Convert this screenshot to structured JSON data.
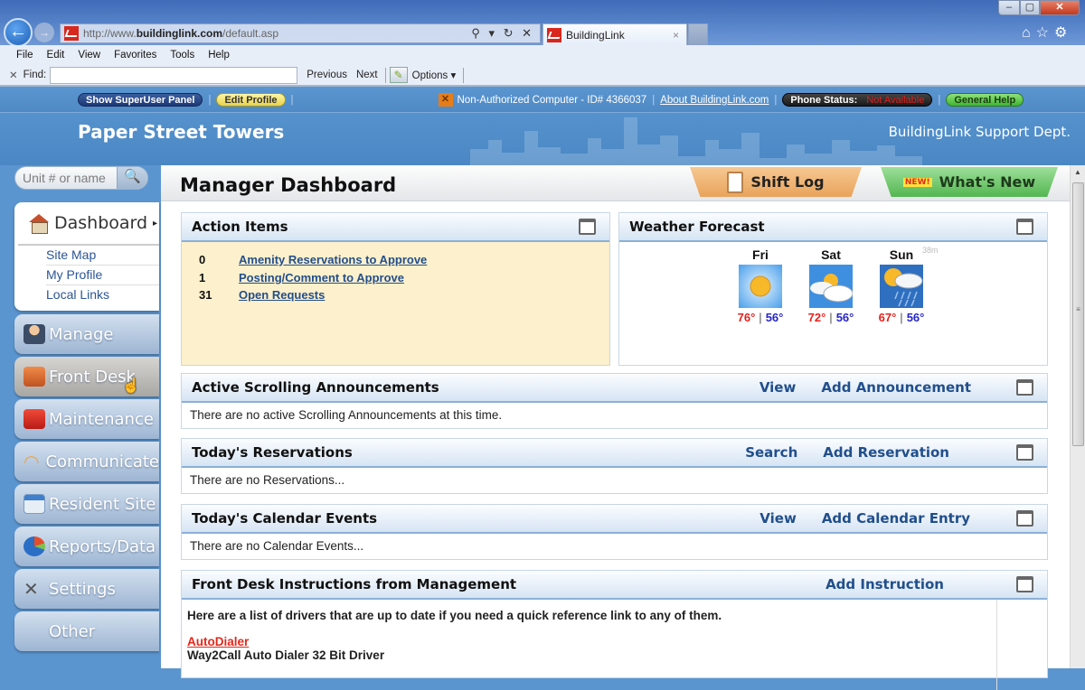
{
  "browser": {
    "url_prefix": "http://www.",
    "url_host": "buildinglink.com",
    "url_path": "/default.asp",
    "address_tools": "⚲ ▾ ↻ ✕",
    "tab_title": "BuildingLink",
    "tab_close": "×",
    "menu": [
      "File",
      "Edit",
      "View",
      "Favorites",
      "Tools",
      "Help"
    ],
    "find_label": "Find:",
    "find_value": "",
    "find_previous": "Previous",
    "find_next": "Next",
    "find_options": "Options ▾",
    "window_controls": {
      "minimize": "–",
      "maximize": "▢",
      "close": "✕"
    },
    "right_tools": "⌂☆⚙"
  },
  "topbar": {
    "superuser_button": "Show SuperUser Panel",
    "edit_profile_button": "Edit Profile",
    "computer_status": "Non-Authorized Computer - ID#  4366037",
    "about_link": "About BuildingLink.com",
    "phone_status_label": "Phone Status:",
    "phone_status_value": "Not Available",
    "general_help_button": "General Help"
  },
  "header": {
    "building_name": "Paper Street Towers",
    "department": "BuildingLink Support Dept."
  },
  "sidebar": {
    "search_placeholder": "Unit # or name",
    "search_icon": "🔍",
    "dashboard_label": "Dashboard",
    "dashboard_arrow": "▸",
    "sublinks": [
      "Site Map",
      "My Profile",
      "Local Links"
    ],
    "nav": [
      {
        "label": "Manage",
        "icon": "manager-icon",
        "color": "#4f6a8f"
      },
      {
        "label": "Front Desk",
        "icon": "front-desk-icon",
        "color": "#d8642c"
      },
      {
        "label": "Maintenance",
        "icon": "toolbox-icon",
        "color": "#d42a22"
      },
      {
        "label": "Communicate",
        "icon": "wifi-icon",
        "color": "#f0a23a"
      },
      {
        "label": "Resident Site",
        "icon": "website-icon",
        "color": "#7a9cc4"
      },
      {
        "label": "Reports/Data",
        "icon": "pie-chart-icon",
        "color": "#2a6ec6"
      },
      {
        "label": "Settings",
        "icon": "tools-icon",
        "color": "#888888"
      },
      {
        "label": "Other",
        "icon": "",
        "color": ""
      }
    ]
  },
  "main": {
    "title": "Manager Dashboard",
    "shift_log_tab": "Shift Log",
    "whats_new_badge": "NEW!",
    "whats_new_tab": "What's New",
    "action_items": {
      "title": "Action Items",
      "rows": [
        {
          "count": "0",
          "label": "Amenity Reservations to Approve"
        },
        {
          "count": "1",
          "label": "Posting/Comment to Approve"
        },
        {
          "count": "31",
          "label": "Open Requests"
        }
      ]
    },
    "weather": {
      "title": "Weather Forecast",
      "age": "38m",
      "days": [
        {
          "day": "Fri",
          "condition": "sunny",
          "high": "76°",
          "low": "56°"
        },
        {
          "day": "Sat",
          "condition": "partly-cloudy",
          "high": "72°",
          "low": "56°"
        },
        {
          "day": "Sun",
          "condition": "rain-showers",
          "high": "67°",
          "low": "56°"
        }
      ]
    },
    "announcements": {
      "title": "Active Scrolling Announcements",
      "link1": "View",
      "link2": "Add Announcement",
      "empty": "There are no active Scrolling Announcements at this time."
    },
    "reservations": {
      "title": "Today's Reservations",
      "link1": "Search",
      "link2": "Add Reservation",
      "empty": "There are no Reservations..."
    },
    "calendar": {
      "title": "Today's Calendar Events",
      "link1": "View",
      "link2": "Add Calendar Entry",
      "empty": "There are no Calendar Events..."
    },
    "instructions": {
      "title": "Front Desk Instructions from Management",
      "link": "Add Instruction",
      "intro": "Here are a list of drivers that are up to date if you need a quick reference link to any of them.",
      "item_link": "AutoDialer",
      "item_desc": "Way2Call Auto Dialer 32 Bit Driver"
    }
  }
}
